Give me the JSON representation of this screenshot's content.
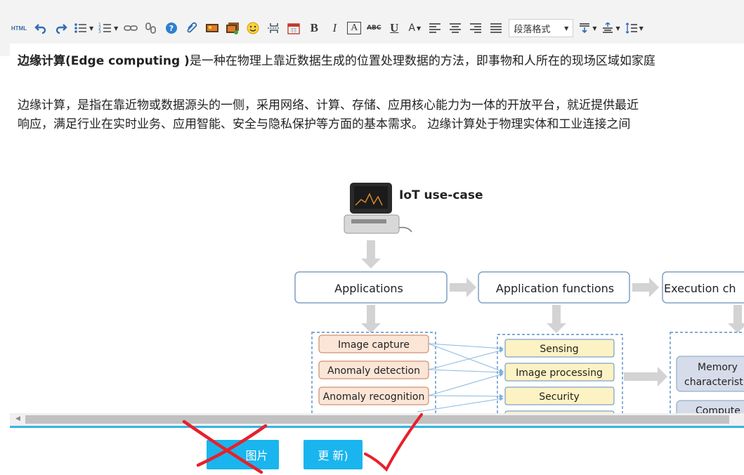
{
  "toolbar": {
    "html_label": "HTML",
    "bold_label": "B",
    "italic_label": "I",
    "boxed_a_label": "A",
    "strike_label": "ABC",
    "underline_label": "U",
    "font_color_label": "A",
    "paragraph_format": "段落格式"
  },
  "content": {
    "para1_bold": "边缘计算(Edge computing )",
    "para1_rest": "是一种在物理上靠近数据生成的位置处理数据的方法，即事物和人所在的现场区域如家庭",
    "para2_line1": "边缘计算，是指在靠近物或数据源头的一侧，采用网络、计算、存储、应用核心能力为一体的开放平台，就近提供最近",
    "para2_line2": "响应，满足行业在实时业务、应用智能、安全与隐私保护等方面的基本需求。 边缘计算处于物理实体和工业连接之间"
  },
  "diagram": {
    "iot_label": "IoT use-case",
    "col1_title": "Applications",
    "col2_title": "Application functions",
    "col3_title": "Execution ch",
    "apps": [
      "Image capture",
      "Anomaly detection",
      "Anomaly recognition"
    ],
    "functions": [
      "Sensing",
      "Image processing",
      "Security"
    ],
    "exec": [
      "Memory",
      "characterist",
      "Compute"
    ]
  },
  "footer": {
    "button1_label": "图片",
    "button2_label": "更 新)"
  },
  "colors": {
    "accent": "#1ab5ee",
    "divider": "#33b5e5",
    "app_fill": "#fbe5d6",
    "function_fill": "#fdf2c3",
    "exec_fill": "#d6dce9",
    "annotation_red": "#e8202a"
  }
}
